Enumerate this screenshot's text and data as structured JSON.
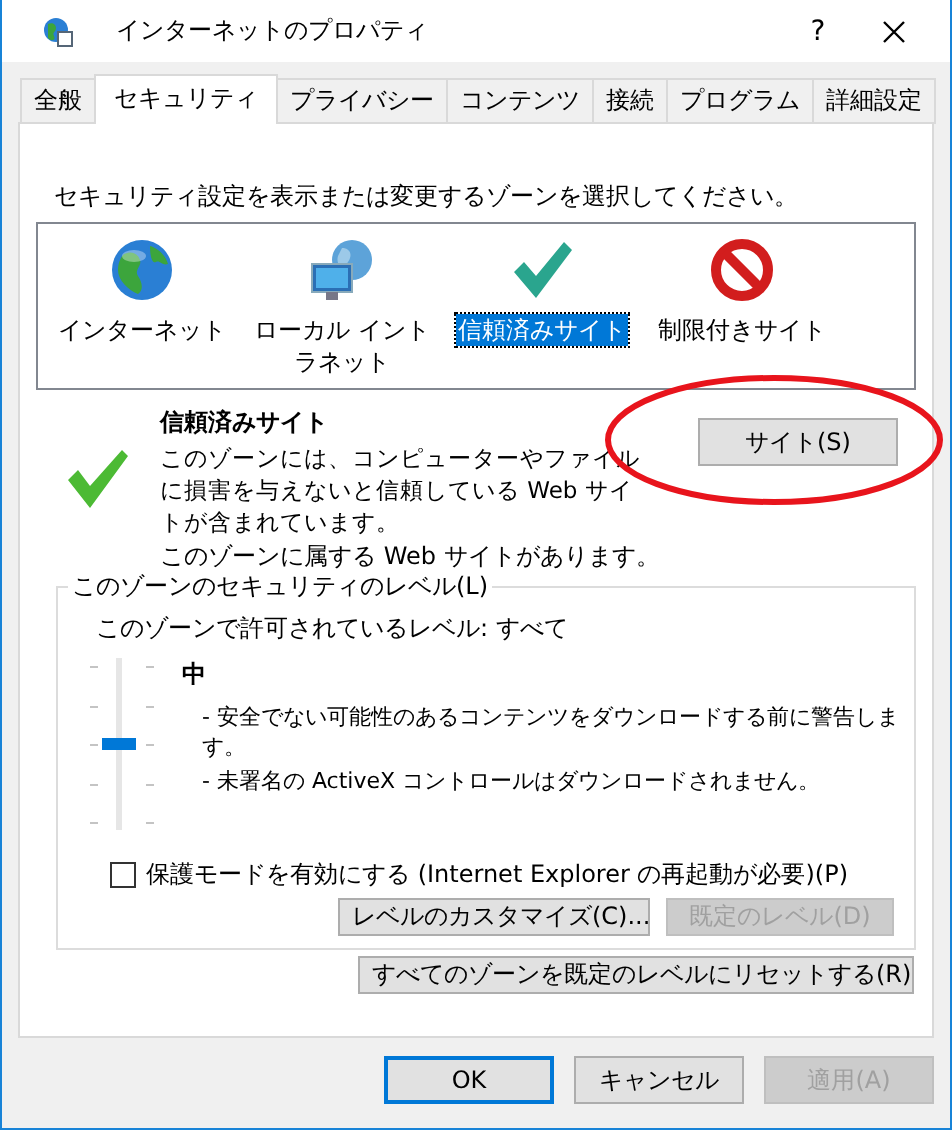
{
  "window": {
    "title": "インターネットのプロパティ",
    "help": "?"
  },
  "tabs": [
    {
      "label": "全般",
      "selected": false
    },
    {
      "label": "セキュリティ",
      "selected": true
    },
    {
      "label": "プライバシー",
      "selected": false
    },
    {
      "label": "コンテンツ",
      "selected": false
    },
    {
      "label": "接続",
      "selected": false
    },
    {
      "label": "プログラム",
      "selected": false
    },
    {
      "label": "詳細設定",
      "selected": false
    }
  ],
  "instruction": "セキュリティ設定を表示または変更するゾーンを選択してください。",
  "zones": [
    {
      "label": "インターネット",
      "kind": "globe",
      "selected": false
    },
    {
      "label": "ローカル イントラネット",
      "kind": "intranet",
      "selected": false
    },
    {
      "label": "信頼済みサイト",
      "kind": "trusted",
      "selected": true
    },
    {
      "label": "制限付きサイト",
      "kind": "restricted",
      "selected": false
    }
  ],
  "zone_detail": {
    "kind": "trusted",
    "title": "信頼済みサイト",
    "description": "このゾーンには、コンピューターやファイルに損害を与えないと信頼している Web サイトが含まれています。",
    "site_button": "サイト(S)",
    "status": "このゾーンに属する Web サイトがあります。"
  },
  "security_level": {
    "legend": "このゾーンのセキュリティのレベル(L)",
    "allowed": "このゾーンで許可されているレベル: すべて",
    "level": 0.5,
    "name": "中",
    "notes": [
      "- 安全でない可能性のあるコンテンツをダウンロードする前に警告します。",
      "- 未署名の ActiveX コントロールはダウンロードされません。"
    ],
    "protected_mode": {
      "label": "保護モードを有効にする (Internet Explorer の再起動が必要)(P)",
      "checked": false
    },
    "buttons": [
      {
        "label": "レベルのカスタマイズ(C)...",
        "disabled": false
      },
      {
        "label": "既定のレベル(D)",
        "disabled": true
      }
    ]
  },
  "reset_button": {
    "label": "すべてのゾーンを既定のレベルにリセットする(R)",
    "disabled": false
  },
  "dialog_buttons": [
    {
      "label": "OK",
      "default": true,
      "disabled": false
    },
    {
      "label": "キャンセル",
      "default": false,
      "disabled": false
    },
    {
      "label": "適用(A)",
      "default": false,
      "disabled": true
    }
  ]
}
